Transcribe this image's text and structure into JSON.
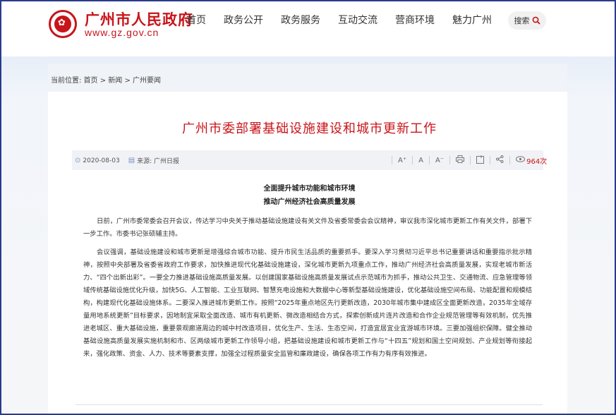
{
  "header": {
    "site_name": "广州市人民政府",
    "site_url": "www.gz.gov.cn",
    "nav": [
      "首页",
      "政务公开",
      "政务服务",
      "互动交流",
      "营商环境",
      "魅力广州"
    ],
    "search_label": "搜索"
  },
  "breadcrumb": "当前位置: 首页 > 新闻 > 广州要闻",
  "article": {
    "title": "广州市委部署基础设施建设和城市更新工作",
    "date": "2020-08-03",
    "source": "来源: 广州日报",
    "tools": [
      "A⁺",
      "A",
      "A⁻"
    ],
    "views": "964次",
    "subtitle1": "全面提升城市功能和城市环境",
    "subtitle2": "推动广州经济社会高质量发展",
    "paragraph1": "日前，广州市委常委会召开会议，传达学习中央关于推动基础设施建设有关文件及省委常委会会议精神，审议我市深化城市更新工作有关文件，部署下一步工作。市委书记张硕辅主持。",
    "paragraph2": "会议强调，基础设施建设和城市更新是增强综合城市功能、提升市民生活品质的重要抓手。要深入学习贯彻习近平总书记重要讲话和重要指示批示精神，按照中央部署及省委省政府工作要求，加快推进现代化基础设施建设，深化城市更新九项重点工作，推动广州经济社会高质量发展，实现老城市新活力、“四个出新出彩”。一要全力推进基础设施高质量发展。以创建国家基础设施高质量发展试点示范城市为抓手，推动公共卫生、交通物流、应急管理等领域传统基础设施优化升级，加快5G、人工智能、工业互联网、智慧充电设施和大数据中心等新型基础设施建设，优化基础设施空间布局、功能配置和规模结构，构建现代化基础设施体系。二要深入推进城市更新工作。按照“2025年重点地区先行更新改造，2030年城市集中建成区全面更新改造，2035年全域存量用地系统更新”目标要求，因地制宜采取全面改造、城市有机更新、微改造相结合方式，探索创新成片连片改造和合作企业规范管理等有效机制，优先推进老城区、重大基础设施，重要景观廊道周边的城中村改造项目，优化生产、生活、生态空间，打造宜居宜业宜游城市环境。三要加强组织保障。健全推动基础设施高质量发展实施机制和市、区两级城市更新工作领导小组，把基础设施建设和城市更新工作与“十四五”规划和国土空间规划、产业规划等衔接起来，强化政策、资金、人力、技术等要素支撑，加强全过程质量安全监管和廉政建设，确保各项工作有力有序有效推进。"
  },
  "colors": {
    "brand_red": "#c8141a",
    "frame_blue": "#2a3a8c"
  }
}
